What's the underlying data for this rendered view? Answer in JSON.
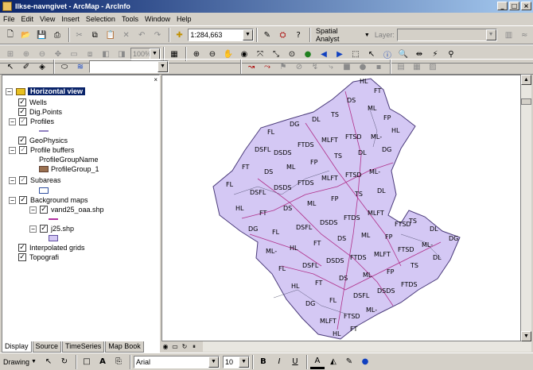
{
  "window": {
    "title": "Ilkse-navngivet - ArcMap - ArcInfo"
  },
  "menu": [
    "File",
    "Edit",
    "View",
    "Insert",
    "Selection",
    "Tools",
    "Window",
    "Help"
  ],
  "toolbar": {
    "scale_value": "1:284,663",
    "extension_label": "Spatial Analyst",
    "layer_label": "Layer:",
    "layer_value": "",
    "zoom_value": "100%"
  },
  "toc": {
    "data_frame": "Horizontal view",
    "layers": [
      {
        "label": "Wells",
        "checked": true
      },
      {
        "label": "Dig.Points",
        "checked": true
      },
      {
        "label": "Profiles",
        "checked": "partial"
      },
      {
        "label": "GeoPhysics",
        "checked": true
      },
      {
        "label": "Profile buffers",
        "checked": "partial"
      },
      {
        "label": "ProfileGroupName"
      },
      {
        "label": "ProfileGroup_1"
      },
      {
        "label": "Subareas",
        "checked": "partial"
      },
      {
        "label": "Background maps",
        "checked": true
      },
      {
        "label": "vand25_oaa.shp",
        "checked": true
      },
      {
        "label": "j25.shp",
        "checked": true
      },
      {
        "label": "Interpolated grids",
        "checked": true
      },
      {
        "label": "Topografi",
        "checked": true
      }
    ],
    "tabs": [
      "Display",
      "Source",
      "TimeSeries",
      "Map Book"
    ]
  },
  "map": {
    "labels": [
      "HL",
      "FT",
      "DS",
      "ML",
      "FP",
      "TS",
      "DL",
      "DG",
      "FL",
      "DSFL",
      "DSDS",
      "FTDS",
      "MLFT",
      "FTSD",
      "ML-"
    ]
  },
  "drawing": {
    "menu_label": "Drawing",
    "font_name": "Arial",
    "font_size": "10"
  },
  "colors": {
    "title_start": "#0a246a",
    "title_end": "#a6caf0",
    "polygon_fill": "#d4c8f4",
    "polygon_edge": "#4a3a7a",
    "line_color": "#b0308a"
  }
}
